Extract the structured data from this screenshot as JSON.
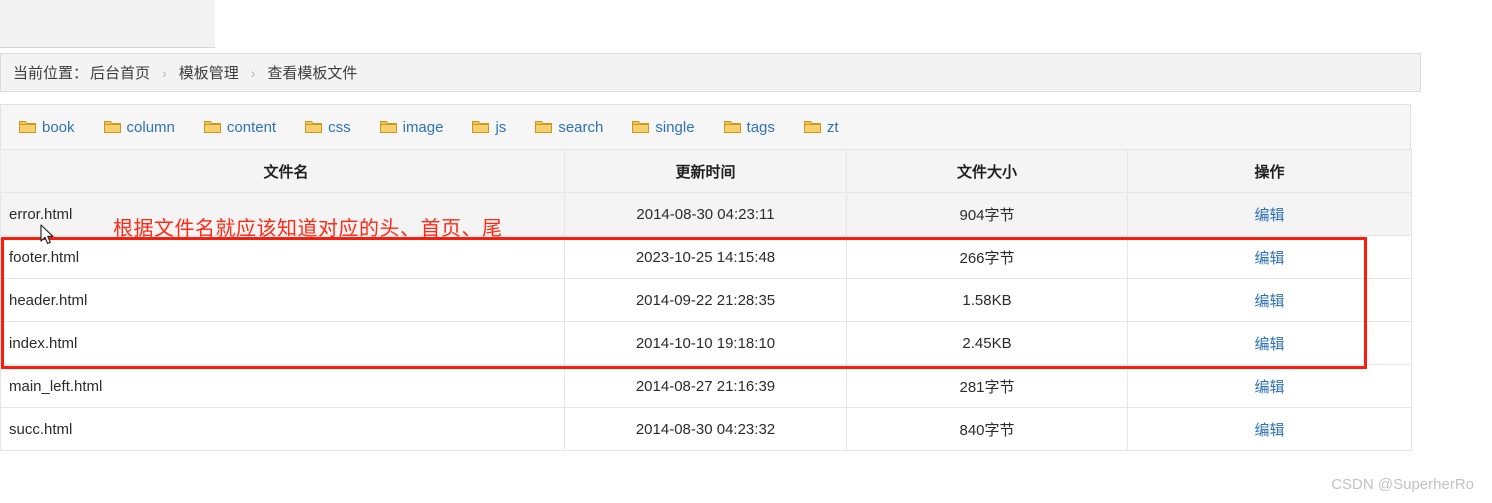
{
  "breadcrumb": {
    "label": "当前位置：",
    "items": [
      "后台首页",
      "模板管理",
      "查看模板文件"
    ],
    "separator": "›"
  },
  "folders": [
    {
      "name": "book",
      "icon": "folder-icon"
    },
    {
      "name": "column",
      "icon": "folder-icon"
    },
    {
      "name": "content",
      "icon": "folder-icon"
    },
    {
      "name": "css",
      "icon": "folder-icon"
    },
    {
      "name": "image",
      "icon": "folder-icon"
    },
    {
      "name": "js",
      "icon": "folder-icon"
    },
    {
      "name": "search",
      "icon": "folder-icon"
    },
    {
      "name": "single",
      "icon": "folder-icon"
    },
    {
      "name": "tags",
      "icon": "folder-icon"
    },
    {
      "name": "zt",
      "icon": "folder-icon"
    }
  ],
  "table": {
    "headers": [
      "文件名",
      "更新时间",
      "文件大小",
      "操作"
    ],
    "action_label": "编辑",
    "rows": [
      {
        "name": "error.html",
        "time": "2014-08-30 04:23:11",
        "size": "904字节",
        "action": "编辑"
      },
      {
        "name": "footer.html",
        "time": "2023-10-25 14:15:48",
        "size": "266字节",
        "action": "编辑"
      },
      {
        "name": "header.html",
        "time": "2014-09-22 21:28:35",
        "size": "1.58KB",
        "action": "编辑"
      },
      {
        "name": "index.html",
        "time": "2014-10-10 19:18:10",
        "size": "2.45KB",
        "action": "编辑"
      },
      {
        "name": "main_left.html",
        "time": "2014-08-27 21:16:39",
        "size": "281字节",
        "action": "编辑"
      },
      {
        "name": "succ.html",
        "time": "2014-08-30 04:23:32",
        "size": "840字节",
        "action": "编辑"
      }
    ]
  },
  "annotation": {
    "text": "根据文件名就应该知道对应的头、首页、尾",
    "color": "#ff2a16",
    "box_color": "#ff1b0b"
  },
  "watermark": {
    "text": "CSDN @SuperherRo"
  },
  "colors": {
    "link": "#2f72b8",
    "header_bg": "#f4f4f4",
    "border": "#e6e6e6"
  }
}
